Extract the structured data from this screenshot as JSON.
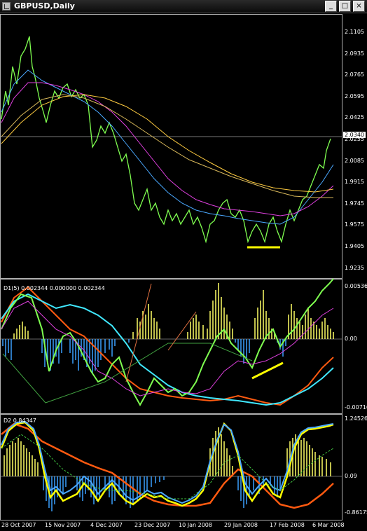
{
  "window": {
    "title": "GBPUSD,Daily",
    "buttons": {
      "minimize": "_",
      "maximize": "□",
      "close": "×"
    }
  },
  "price_panel": {
    "current_price": "2.0340",
    "y_labels": [
      "2.1105",
      "2.0935",
      "2.0765",
      "2.0595",
      "2.0425",
      "2.0255",
      "2.0085",
      "1.9915",
      "1.9745",
      "1.9575",
      "1.9405",
      "1.9235"
    ]
  },
  "indicator1": {
    "label": "D1(5) 0.002344 0.000000 0.002344",
    "y_labels": [
      "0.00536",
      "0.00",
      "-0.00716"
    ]
  },
  "indicator2": {
    "label": "D2 0.84347",
    "y_labels": [
      "1.24526",
      "0.09",
      "-0.86175"
    ]
  },
  "date_labels": [
    "28 Oct 2007",
    "15 Nov 2007",
    "4 Dec 2007",
    "23 Dec 2007",
    "10 Jan 2008",
    "29 Jan 2008",
    "17 Feb 2008",
    "6 Mar 2008"
  ],
  "colors": {
    "price": "#7fff50",
    "ma_fast": "#4aa8ff",
    "ma_mid": "#e040e0",
    "ma_slow": "#ffcc40",
    "hist_pos": "#ffff66",
    "hist_neg": "#3aa0ff",
    "orange": "#ff5a10",
    "cyan": "#40e8ff",
    "yellow": "#ffff00",
    "marker_yellow": "#ffff00"
  }
}
